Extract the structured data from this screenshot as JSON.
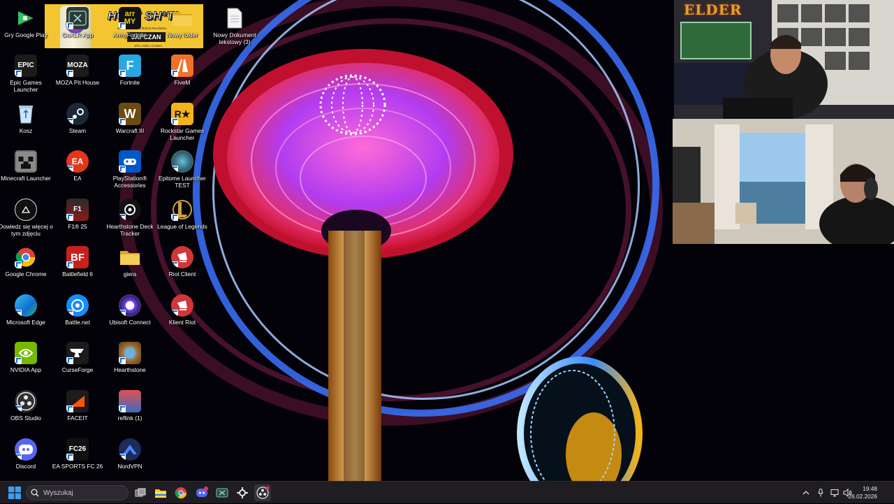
{
  "desktop_icons": [
    {
      "label": "Gry Google Play",
      "icon": "google-play-games-icon",
      "color": "#1e8e3e"
    },
    {
      "label": "Epic Games Launcher",
      "icon": "epic-games-icon",
      "color": "#1b1b1b"
    },
    {
      "label": "Kosz",
      "icon": "recycle-bin-icon",
      "color": "#2d6fb4"
    },
    {
      "label": "Minecraft Launcher",
      "icon": "minecraft-icon",
      "color": "#6b6b6b"
    },
    {
      "label": "Dowiedz się więcej o tym zdjęciu",
      "icon": "spotlight-info-icon",
      "color": "#222222"
    },
    {
      "label": "Google Chrome",
      "icon": "chrome-icon",
      "color": "#dd4b39"
    },
    {
      "label": "Microsoft Edge",
      "icon": "edge-icon",
      "color": "#1f8ed6"
    },
    {
      "label": "NVIDIA App",
      "icon": "nvidia-icon",
      "color": "#76b900"
    },
    {
      "label": "OBS Studio",
      "icon": "obs-icon",
      "color": "#302e31"
    },
    {
      "label": "Discord",
      "icon": "discord-icon",
      "color": "#5865f2"
    },
    {
      "label": "GoXLR App",
      "icon": "goxlr-icon",
      "color": "#2b3a36"
    },
    {
      "label": "MOZA Pit House",
      "icon": "moza-icon",
      "color": "#1c1c1c"
    },
    {
      "label": "Steam",
      "icon": "steam-icon",
      "color": "#1b2838"
    },
    {
      "label": "EA",
      "icon": "ea-icon",
      "color": "#e4361b"
    },
    {
      "label": "F1® 25",
      "icon": "f1-icon",
      "color": "#8b1b1b"
    },
    {
      "label": "Battlefield 6",
      "icon": "battlefield-icon",
      "color": "#c8201d"
    },
    {
      "label": "Battle.net",
      "icon": "battlenet-icon",
      "color": "#148eff"
    },
    {
      "label": "CurseForge",
      "icon": "curseforge-icon",
      "color": "#1c1c1c"
    },
    {
      "label": "FACEIT",
      "icon": "faceit-icon",
      "color": "#1c1c1c"
    },
    {
      "label": "EA SPORTS FC 26",
      "icon": "fc26-icon",
      "color": "#111111"
    },
    {
      "label": "ArmyFortnite",
      "icon": "armyfortnite-icon",
      "color": "#111111"
    },
    {
      "label": "Fortnite",
      "icon": "fortnite-icon",
      "color": "#27a8e0"
    },
    {
      "label": "Warcraft III",
      "icon": "warcraft-icon",
      "color": "#6b4b12"
    },
    {
      "label": "PlayStation® Accessories",
      "icon": "playstation-icon",
      "color": "#0058c8"
    },
    {
      "label": "Hearthstone Deck Tracker",
      "icon": "hdt-icon",
      "color": "#111111"
    },
    {
      "label": "giera",
      "icon": "folder-icon",
      "color": "#e8c04a"
    },
    {
      "label": "Ubisoft Connect",
      "icon": "ubisoft-icon",
      "color": "#2a2a6e"
    },
    {
      "label": "Hearthstone",
      "icon": "hearthstone-icon",
      "color": "#a0743a"
    },
    {
      "label": "reflink (1)",
      "icon": "reflink-icon",
      "color": "#3a6cc0"
    },
    {
      "label": "NordVPN",
      "icon": "nordvpn-icon",
      "color": "#1b2b5a"
    },
    {
      "label": "Nowy folder",
      "icon": "folder-icon",
      "color": "#e8c04a"
    },
    {
      "label": "FiveM",
      "icon": "fivem-icon",
      "color": "#f0722a"
    },
    {
      "label": "Rockstar Games Launcher",
      "icon": "rockstar-icon",
      "color": "#f4b31a"
    },
    {
      "label": "Epitome Launcher TEST",
      "icon": "epitome-icon",
      "color": "#3a7a8a"
    },
    {
      "label": "League of Legends",
      "icon": "league-icon",
      "color": "#c8a13a"
    },
    {
      "label": "Riot Client",
      "icon": "riot-icon",
      "color": "#d13639"
    },
    {
      "label": "Klient Riot",
      "icon": "riot-icon",
      "color": "#d13639"
    },
    {
      "label": "Nowy Dokument tekstowy (3)",
      "icon": "text-document-icon",
      "color": "#f4f4f4"
    }
  ],
  "glyph_text": {
    "epic": "EPIC",
    "moza": "MOZA",
    "fc26": "FC26",
    "army": "arr MY",
    "fortnite": "F",
    "bf": "BF",
    "ea": "EA",
    "warcraft": "W",
    "rockstar": "R★",
    "f1": "F1"
  },
  "banner": {
    "title": "HOLY SH*T!",
    "subtitle": "Dołącz do The Softdrink Revolution",
    "name": "JAPCZAN",
    "note": "10% zniżki z kodem"
  },
  "webcam": {
    "logo": "ELDER"
  },
  "taskbar": {
    "search_placeholder": "Wyszukaj",
    "time": "19:48",
    "date": "26.02.2026",
    "apps": [
      "task-view-icon",
      "file-explorer-icon",
      "chrome-icon",
      "discord-icon",
      "goxlr-icon",
      "steelseries-icon",
      "obs-icon"
    ]
  }
}
